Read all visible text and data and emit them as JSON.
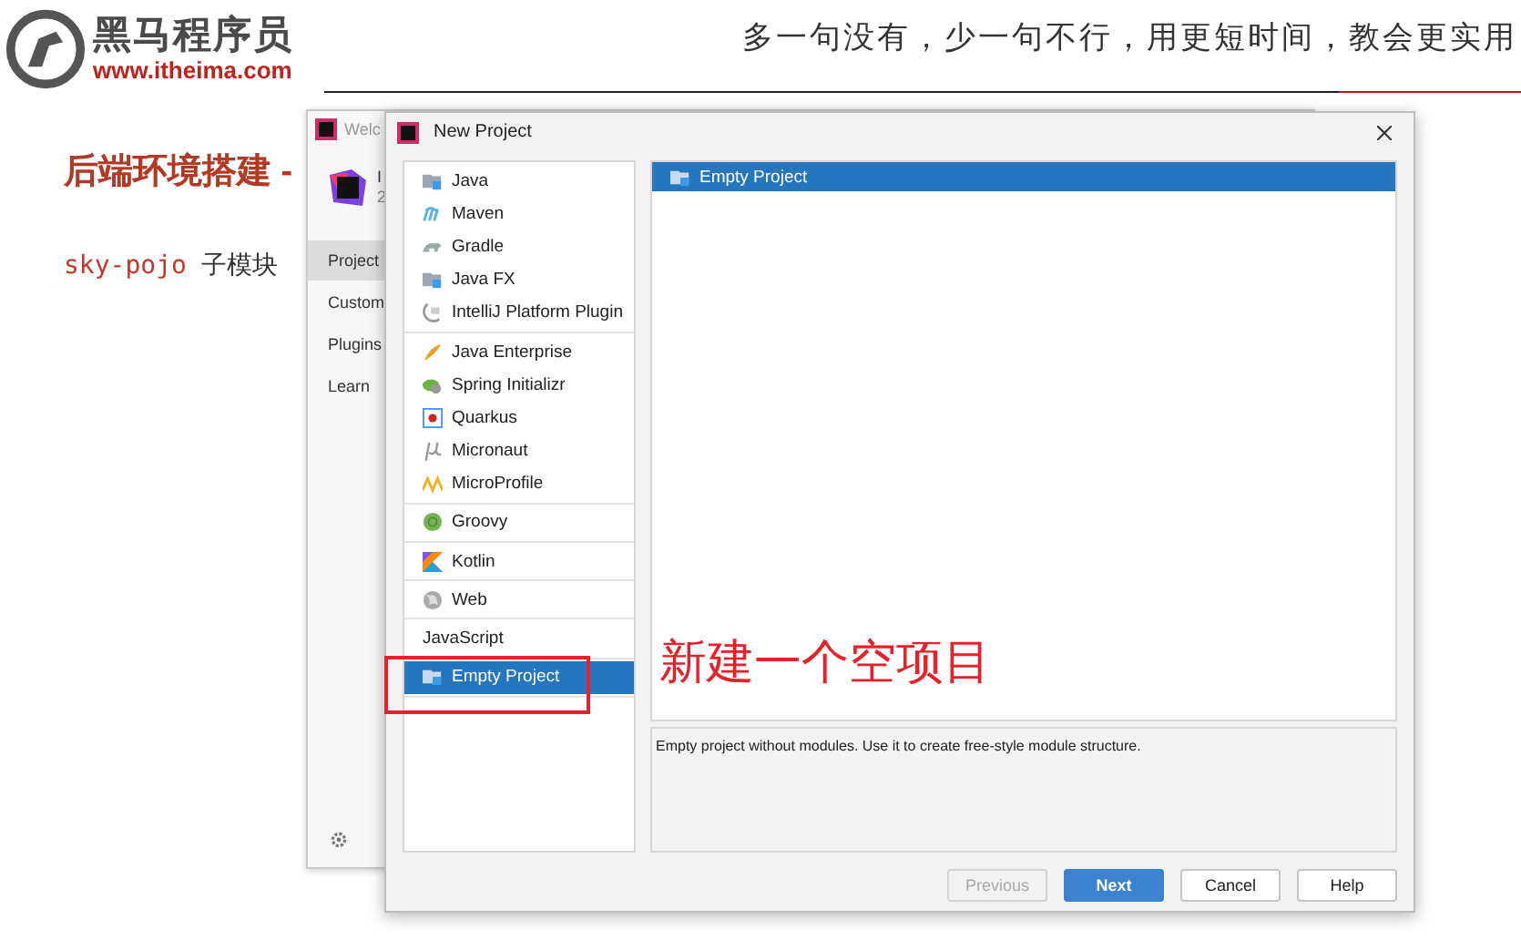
{
  "slide": {
    "logo_name": "黑马程序员",
    "logo_url": "www.itheima.com",
    "tagline": "多一句没有，少一句不行，用更短时间，教会更实用",
    "heading": "后端环境搭建 -",
    "code_term": "sky-pojo",
    "body_text": "子模块"
  },
  "welcome_window": {
    "title": "Welc",
    "app_name": "I",
    "app_version": "2",
    "sidebar": [
      {
        "label": "Project",
        "selected": true
      },
      {
        "label": "Custom",
        "selected": false
      },
      {
        "label": "Plugins",
        "selected": false
      },
      {
        "label": "Learn",
        "selected": false
      }
    ]
  },
  "dialog": {
    "title": "New Project",
    "groups": [
      [
        {
          "label": "Java",
          "selected": false
        },
        {
          "label": "Maven",
          "selected": false
        },
        {
          "label": "Gradle",
          "selected": false
        },
        {
          "label": "Java FX",
          "selected": false
        },
        {
          "label": "IntelliJ Platform Plugin",
          "selected": false
        }
      ],
      [
        {
          "label": "Java Enterprise",
          "selected": false
        },
        {
          "label": "Spring Initializr",
          "selected": false
        },
        {
          "label": "Quarkus",
          "selected": false
        },
        {
          "label": "Micronaut",
          "selected": false
        },
        {
          "label": "MicroProfile",
          "selected": false
        }
      ],
      [
        {
          "label": "Groovy",
          "selected": false
        }
      ],
      [
        {
          "label": "Kotlin",
          "selected": false
        }
      ],
      [
        {
          "label": "Web",
          "selected": false
        }
      ],
      [
        {
          "label": "JavaScript",
          "selected": false
        }
      ],
      [
        {
          "label": "Empty Project",
          "selected": true
        }
      ]
    ],
    "project_types": [
      {
        "label": "Empty Project",
        "selected": true
      }
    ],
    "description": "Empty project without modules. Use it to create free-style module structure.",
    "buttons": [
      {
        "label": "Previous",
        "disabled": true,
        "primary": false
      },
      {
        "label": "Next",
        "disabled": false,
        "primary": true
      },
      {
        "label": "Cancel",
        "disabled": false,
        "primary": false
      },
      {
        "label": "Help",
        "disabled": false,
        "primary": false
      }
    ]
  },
  "annotation": {
    "text": "新建一个空项目"
  }
}
